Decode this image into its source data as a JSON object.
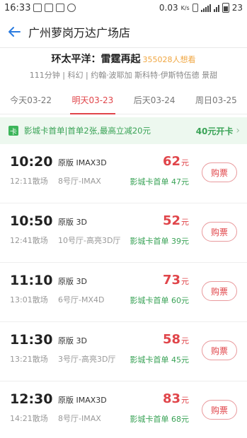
{
  "status_bar": {
    "time": "16:33",
    "net_speed": "0.03",
    "battery": "23"
  },
  "header": {
    "title": "广州萝岗万达广场店"
  },
  "movie": {
    "title": "环太平洋：雷霆再起",
    "want_count": "355028人想看",
    "info": "111分钟 | 科幻 | 约翰·波耶加 斯科特·伊斯特伍德 景甜"
  },
  "date_tabs": [
    {
      "label": "今天03-22"
    },
    {
      "label": "明天03-23"
    },
    {
      "label": "后天03-24"
    },
    {
      "label": "周日03-25"
    }
  ],
  "active_tab": 1,
  "promo": {
    "badge": "卡",
    "text": "影城卡首单|首单2张,最高立减20元",
    "cta": "40元开卡"
  },
  "showtimes": [
    {
      "start": "10:20",
      "end": "12:11散场",
      "lang": "原版 IMAX3D",
      "hall": "8号厅-IMAX",
      "price": "62",
      "unit": "元",
      "card_price": "影城卡首单 47元",
      "buy": "购票"
    },
    {
      "start": "10:50",
      "end": "12:41散场",
      "lang": "原版 3D",
      "hall": "10号厅-高亮3D厅",
      "price": "52",
      "unit": "元",
      "card_price": "影城卡首单 39元",
      "buy": "购票"
    },
    {
      "start": "11:10",
      "end": "13:01散场",
      "lang": "原版 3D",
      "hall": "6号厅-MX4D",
      "price": "73",
      "unit": "元",
      "card_price": "影城卡首单 60元",
      "buy": "购票"
    },
    {
      "start": "11:30",
      "end": "13:21散场",
      "lang": "原版 3D",
      "hall": "3号厅-高亮3D厅",
      "price": "58",
      "unit": "元",
      "card_price": "影城卡首单 45元",
      "buy": "购票"
    },
    {
      "start": "12:30",
      "end": "14:21散场",
      "lang": "原版 IMAX3D",
      "hall": "8号厅-IMAX",
      "price": "83",
      "unit": "元",
      "card_price": "影城卡首单 68元",
      "buy": "购票"
    }
  ],
  "colors": {
    "accent_red": "#e0454a",
    "promo_green": "#3aa357",
    "back_blue": "#2a7be0"
  }
}
